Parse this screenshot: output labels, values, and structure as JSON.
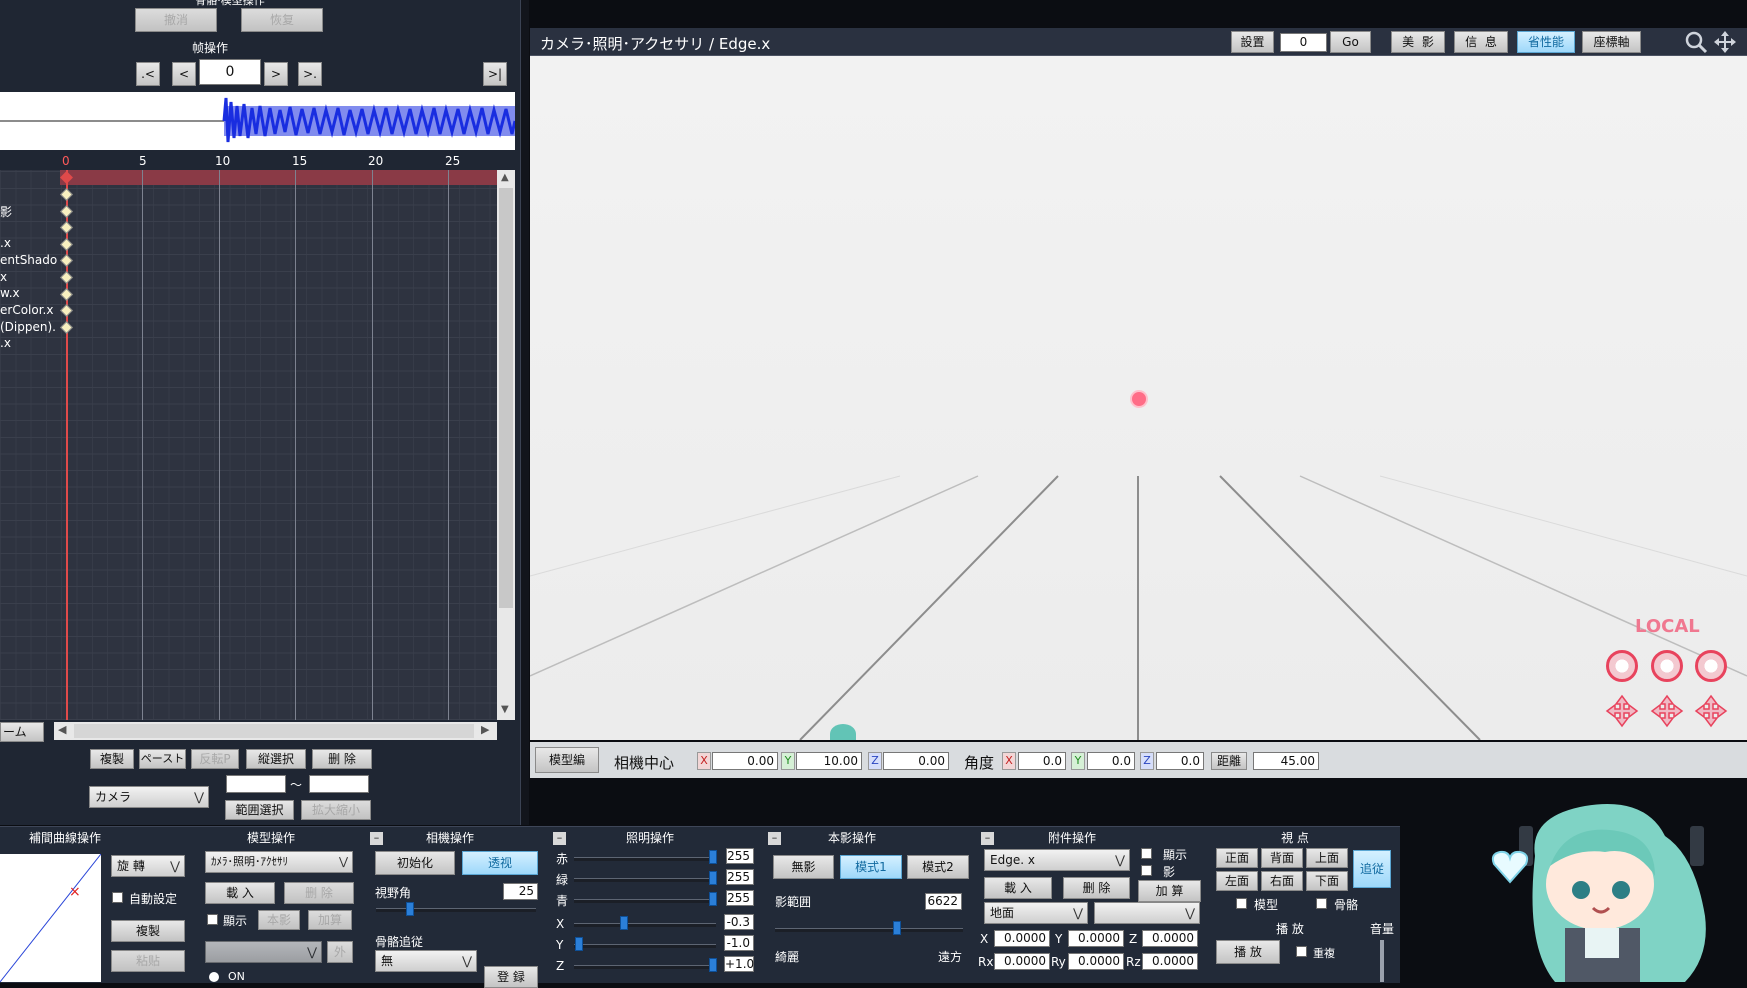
{
  "top_left": {
    "section_label": "骨骼·模型操作",
    "undo": "撤消",
    "redo": "恢复"
  },
  "frame_ops": {
    "title": "帧操作",
    "btn_first": ".<",
    "btn_prev": "<",
    "frame_value": "0",
    "btn_next": ">",
    "btn_last": ">.",
    "btn_end": ">|"
  },
  "timeline": {
    "ruler": [
      "0",
      "5",
      "10",
      "15",
      "20",
      "25"
    ],
    "tracks": [
      "",
      "影",
      ".x",
      "entShado",
      "x",
      "w.x",
      "erColor.x",
      "(Dippen).",
      ".x"
    ],
    "frame_button": "ーム"
  },
  "timeline_ops": {
    "copy": "複製",
    "paste": "ペースト",
    "reverse": "反転P",
    "vertical_select": "縦選択",
    "delete": "删 除",
    "target": "カメラ",
    "range_from": "",
    "range_sep": "～",
    "range_to": "",
    "range_select": "範囲選択",
    "scale": "拡大縮小"
  },
  "viewport": {
    "title": "カメラ･照明･アクセサリ / Edge.x",
    "setup": "設置",
    "frame_input": "0",
    "go": "Go",
    "beauty": "美",
    "shadow": "影",
    "info": "信",
    "info2": "息",
    "perf": "省性能",
    "axis": "座標軸",
    "local": "LOCAL"
  },
  "viewport_bottom": {
    "model_edit": "模型編",
    "center_label": "相機中心",
    "center_x": "0.00",
    "center_y": "10.00",
    "center_z": "0.00",
    "angle_label": "角度",
    "angle_x": "0.0",
    "angle_y": "0.0",
    "angle_z": "0.0",
    "dist_label": "距離",
    "dist_value": "45.00",
    "ax_x": "X",
    "ax_y": "Y",
    "ax_z": "Z"
  },
  "interp": {
    "title": "補間曲線操作",
    "rotate": "旋 轉",
    "auto": "自動設定",
    "copy": "複製",
    "paste": "粘贴"
  },
  "model_ops": {
    "title": "模型操作",
    "model_select": "ｶﾒﾗ･照明･ｱｸｾｻﾘ",
    "load": "載 入",
    "delete": "删 除",
    "show": "顯示",
    "shadow": "本影",
    "add": "加算",
    "outside": "外",
    "on": "ON"
  },
  "camera_ops": {
    "title": "相機操作",
    "init": "初始化",
    "perspective": "透视",
    "fov_label": "視野角",
    "fov_value": "25",
    "bone_follow": "骨骼追従",
    "follow_value": "無",
    "register": "登 録"
  },
  "light_ops": {
    "title": "照明操作",
    "r_label": "赤",
    "r": "255",
    "g_label": "緑",
    "g": "255",
    "b_label": "青",
    "b": "255",
    "x_label": "X",
    "x": "-0.3",
    "y_label": "Y",
    "y": "-1.0",
    "z_label": "Z",
    "z": "+1.0"
  },
  "shadow_ops": {
    "title": "本影操作",
    "none": "無影",
    "mode1": "模式1",
    "mode2": "模式2",
    "range_label": "影範囲",
    "range_value": "6622",
    "near": "綺麗",
    "far": "遠方"
  },
  "accessory_ops": {
    "title": "附件操作",
    "selected": "Edge. x",
    "show": "顯示",
    "shadow": "影",
    "load": "載 入",
    "delete": "删 除",
    "add": "加 算",
    "parent": "地面",
    "x_label": "X",
    "x": "0.0000",
    "y_label": "Y",
    "y": "0.0000",
    "z_label": "Z",
    "z": "0.0000",
    "rx_label": "Rx",
    "rx": "0.0000",
    "ry_label": "Ry",
    "ry": "0.0000",
    "rz_label": "Rz",
    "rz": "0.0000"
  },
  "view_ops": {
    "title": "視 点",
    "front": "正面",
    "back": "背面",
    "top": "上面",
    "left": "左面",
    "right": "右面",
    "bottom": "下面",
    "follow": "追従",
    "model": "模型",
    "bone": "骨骼",
    "play_title": "播 放",
    "play": "播 放",
    "repeat": "重複",
    "volume": "音量"
  }
}
